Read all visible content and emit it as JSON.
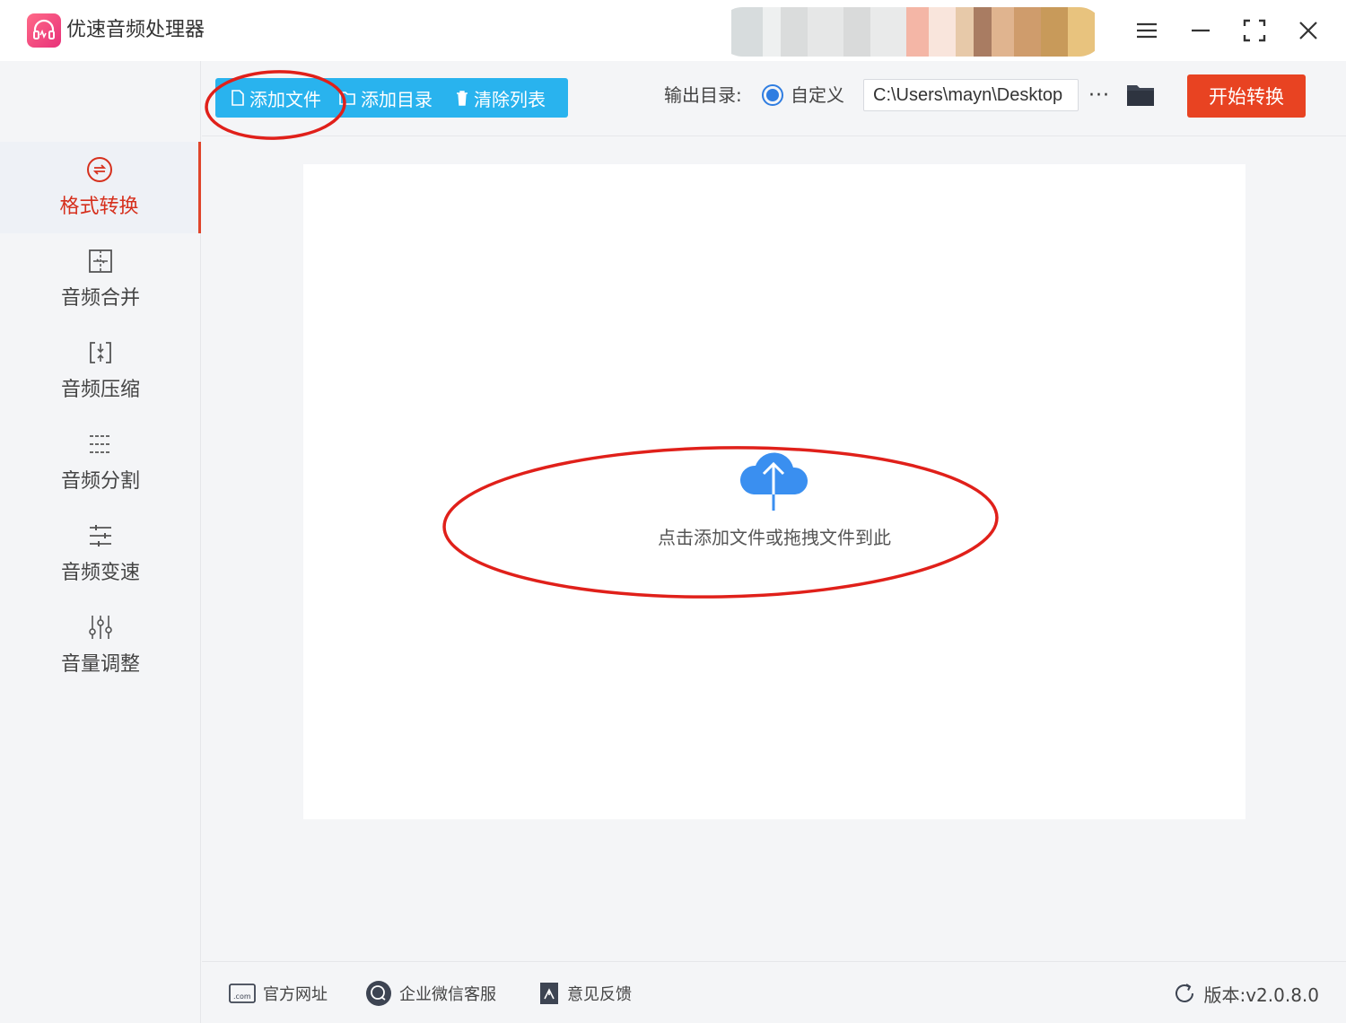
{
  "app": {
    "title": "优速音频处理器"
  },
  "sidebar": {
    "items": [
      {
        "label": "格式转换",
        "icon": "convert-icon",
        "active": true
      },
      {
        "label": "音频合并",
        "icon": "merge-icon",
        "active": false
      },
      {
        "label": "音频压缩",
        "icon": "compress-icon",
        "active": false
      },
      {
        "label": "音频分割",
        "icon": "split-icon",
        "active": false
      },
      {
        "label": "音频变速",
        "icon": "speed-icon",
        "active": false
      },
      {
        "label": "音量调整",
        "icon": "volume-icon",
        "active": false
      }
    ]
  },
  "toolbar": {
    "add_file": "添加文件",
    "add_dir": "添加目录",
    "clear_list": "清除列表",
    "output_label": "输出目录:",
    "custom_label": "自定义",
    "output_path": "C:\\Users\\mayn\\Desktop",
    "more": "···",
    "start": "开始转换"
  },
  "dropzone": {
    "hint": "点击添加文件或拖拽文件到此"
  },
  "footer": {
    "website": "官方网址",
    "wechat": "企业微信客服",
    "feedback": "意见反馈",
    "version": "版本:v2.0.8.0"
  },
  "colors": {
    "accent_blue": "#29b3ee",
    "start_red": "#e84322",
    "active_red": "#d6301d",
    "annotation_red": "#e0201a",
    "upload_blue": "#3a8ff0"
  }
}
